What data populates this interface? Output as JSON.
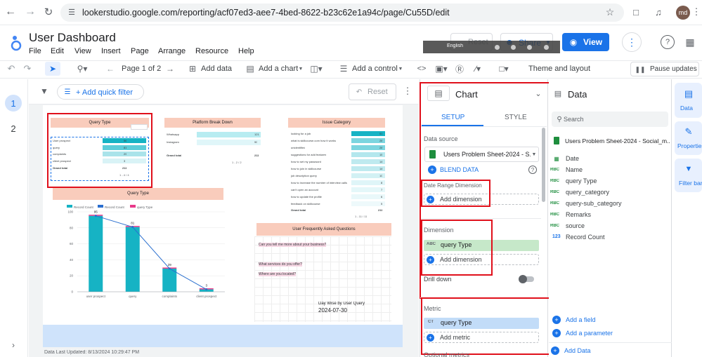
{
  "browser": {
    "url": "lookerstudio.google.com/reporting/acf07ed3-aee7-4bed-8622-b23c62e1a94c/page/Cu55D/edit",
    "avatar": "md"
  },
  "app": {
    "title": "User Dashboard",
    "menu": [
      "File",
      "Edit",
      "View",
      "Insert",
      "Page",
      "Arrange",
      "Resource",
      "Help"
    ],
    "reset": "Reset",
    "share": "Share",
    "view": "View",
    "overlay_label": "English"
  },
  "toolbar": {
    "page": "Page 1 of 2",
    "add_data": "Add data",
    "add_chart": "Add a chart",
    "add_control": "Add a control",
    "theme": "Theme and layout",
    "pause": "Pause updates"
  },
  "pages": [
    "1",
    "2"
  ],
  "filterbar": {
    "add_filter": "+ Add quick filter",
    "reset": "Reset"
  },
  "table1": {
    "title": "Query Type",
    "rows": [
      [
        "User prospect",
        "56"
      ],
      [
        "query",
        "81"
      ],
      [
        "complaints",
        "29"
      ],
      [
        "client prospect",
        "3"
      ]
    ],
    "total": [
      "Grand total",
      "211"
    ],
    "pager": "1 - 4 / 4"
  },
  "table2": {
    "title": "Platform Break Down",
    "rows": [
      [
        "Whatsapp",
        "121"
      ],
      [
        "Instagram",
        "90"
      ]
    ],
    "total": [
      "Grand total",
      "211"
    ],
    "pager": "1 - 2 / 2"
  },
  "table3": {
    "title": "Issue Category",
    "rows": [
      [
        "looking for a job",
        "51"
      ],
      [
        "what is skillcourse.com how it works",
        "28"
      ],
      [
        "unidentified",
        "28"
      ],
      [
        "suggestions for add features",
        "15"
      ],
      [
        "how to set my password",
        "14"
      ],
      [
        "how to join in skillcourse",
        "14"
      ],
      [
        "job description query",
        "10"
      ],
      [
        "how to increase the number of interview calls",
        "8"
      ],
      [
        "can't open an account",
        "7"
      ],
      [
        "how to update the profile",
        "6"
      ],
      [
        "feedback on skillcourse",
        "5"
      ]
    ],
    "total": [
      "Grand total",
      "211"
    ],
    "pager": "1 - 11 / 11"
  },
  "chart_data": {
    "type": "bar",
    "title": "Query Type",
    "categories": [
      "user prospect",
      "query",
      "complaints",
      "client prospect"
    ],
    "series": [
      {
        "name": "Record Count",
        "values": [
          95,
          81,
          29,
          3
        ],
        "color": "#16b3c4"
      },
      {
        "name": "Record Count",
        "values": [
          95,
          81,
          29,
          3
        ],
        "color": "#2a6fcf"
      },
      {
        "name": "query Type",
        "values": [
          0,
          0,
          0,
          0
        ],
        "color": "#e8388a"
      }
    ],
    "data_labels": [
      "95",
      "81",
      "29",
      "3"
    ],
    "yticks": [
      "0",
      "20",
      "40",
      "60",
      "80",
      "100"
    ],
    "ylim": [
      0,
      100
    ]
  },
  "faq": {
    "title": "User Frequently Asked Questions",
    "questions": [
      "Can you tell me more about your business?",
      "What services do you offer?",
      "Where are you located?"
    ],
    "sub_title": "Day Wise by User Query",
    "date": "2024-07-30"
  },
  "footer": {
    "updated": "Data Last Updated: 8/13/2024 10:29:47 PM"
  },
  "props": {
    "title": "Chart",
    "tabs": [
      "SETUP",
      "STYLE"
    ],
    "data_source_label": "Data source",
    "data_source": "Users Problem Sheet-2024 - S...",
    "blend": "BLEND DATA",
    "date_range_label": "Date Range Dimension",
    "add_dimension": "Add dimension",
    "dimension_label": "Dimension",
    "dimension_chip": "query Type",
    "drill_down": "Drill down",
    "metric_label": "Metric",
    "metric_chip": "query Type",
    "add_metric": "Add metric",
    "optional_metrics": "Optional metrics"
  },
  "data_panel": {
    "title": "Data",
    "search_placeholder": "Search",
    "source": "Users Problem Sheet-2024 - Social_m...",
    "fields": [
      {
        "type": "date",
        "name": "Date"
      },
      {
        "type": "abc",
        "name": "Name"
      },
      {
        "type": "abc",
        "name": "query Type"
      },
      {
        "type": "abc",
        "name": "query_category"
      },
      {
        "type": "abc",
        "name": "query-sub_category"
      },
      {
        "type": "abc",
        "name": "Remarks"
      },
      {
        "type": "abc",
        "name": "source"
      },
      {
        "type": "num",
        "name": "Record Count"
      }
    ],
    "add_field": "Add a field",
    "add_parameter": "Add a parameter",
    "add_data": "Add Data"
  },
  "rail": [
    "Data",
    "Properties",
    "Filter bar"
  ],
  "colors": {
    "accent": "#1a73e8",
    "header_peach": "#f9ccbc",
    "bar": "#16b3c4",
    "highlight_red": "#e0101b"
  }
}
